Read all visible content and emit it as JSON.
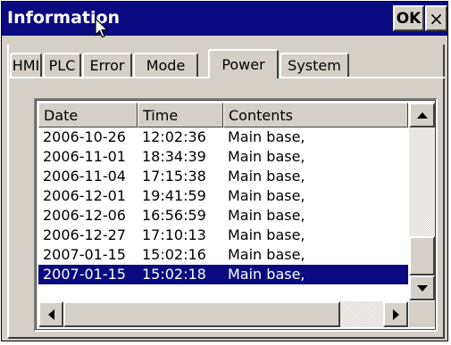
{
  "window": {
    "title": "Information",
    "ok_label": "OK",
    "close_label": "×"
  },
  "tabs": [
    {
      "label": "HMI"
    },
    {
      "label": "PLC"
    },
    {
      "label": "Error"
    },
    {
      "label": "Mode"
    },
    {
      "label": "Power",
      "active": true
    },
    {
      "label": "System"
    }
  ],
  "table": {
    "columns": [
      "Date",
      "Time",
      "Contents"
    ],
    "rows": [
      {
        "date": "2006-10-26",
        "time": "12:02:36",
        "contents": "Main base,"
      },
      {
        "date": "2006-11-01",
        "time": "18:34:39",
        "contents": "Main base,"
      },
      {
        "date": "2006-11-04",
        "time": "17:15:38",
        "contents": "Main base,"
      },
      {
        "date": "2006-12-01",
        "time": "19:41:59",
        "contents": "Main base,"
      },
      {
        "date": "2006-12-06",
        "time": "16:56:59",
        "contents": "Main base,"
      },
      {
        "date": "2006-12-27",
        "time": "17:10:13",
        "contents": "Main base,"
      },
      {
        "date": "2007-01-15",
        "time": "15:02:16",
        "contents": "Main base,"
      },
      {
        "date": "2007-01-15",
        "time": "15:02:18",
        "contents": "Main base,",
        "selected": true
      }
    ]
  },
  "colors": {
    "title_bar": "#0a0a80",
    "selection": "#0a0a80",
    "face": "#d4d0c8"
  }
}
